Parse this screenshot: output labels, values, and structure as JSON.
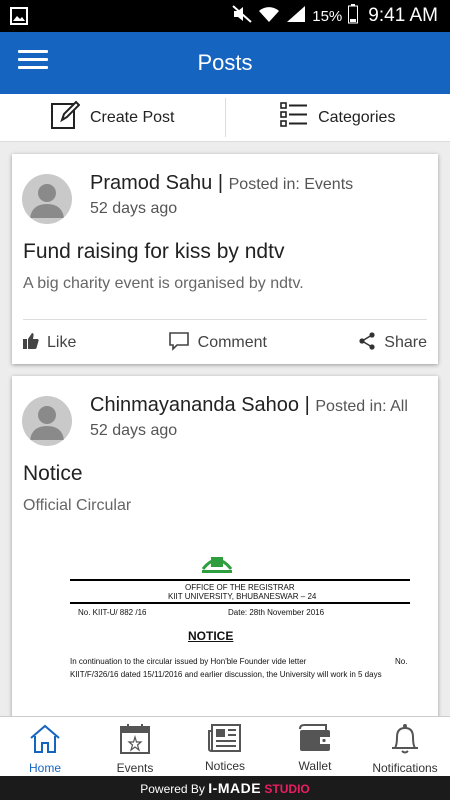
{
  "status_bar": {
    "battery": "15%",
    "time": "9:41 AM"
  },
  "app_bar": {
    "title": "Posts"
  },
  "toolbar": {
    "create_post": "Create Post",
    "categories": "Categories"
  },
  "posts": [
    {
      "author": "Pramod Sahu",
      "separator": "|",
      "posted_in": "Posted in: Events",
      "time_ago": "52 days ago",
      "title": "Fund raising for kiss by ndtv",
      "description": "A big charity event is organised by ndtv.",
      "actions": {
        "like": "Like",
        "comment": "Comment",
        "share": "Share"
      }
    },
    {
      "author": "Chinmayananda Sahoo",
      "separator": "|",
      "posted_in": "Posted in: All",
      "time_ago": "52 days ago",
      "title": "Notice",
      "description": "Official Circular",
      "document": {
        "office": "OFFICE OF THE REGISTRAR",
        "university": "KIIT UNIVERSITY, BHUBANESWAR – 24",
        "ref": "No. KIIT-U/ 882 /16",
        "date": "Date: 28th November 2016",
        "heading": "NOTICE",
        "line1": "In continuation to the circular issued by Hon'ble Founder vide letter",
        "line1_end": "No.",
        "line2": "KIIT/F/326/16 dated 15/11/2016 and earlier discussion, the University will work in 5 days"
      }
    }
  ],
  "bottom_nav": {
    "home": "Home",
    "events": "Events",
    "notices": "Notices",
    "wallet": "Wallet",
    "notifications": "Notifications"
  },
  "footer": {
    "powered_by": "Powered By",
    "brand": "I-MADE",
    "studio": "STUDIO"
  },
  "colors": {
    "primary": "#1565c0",
    "footer_accent": "#e91e63"
  }
}
